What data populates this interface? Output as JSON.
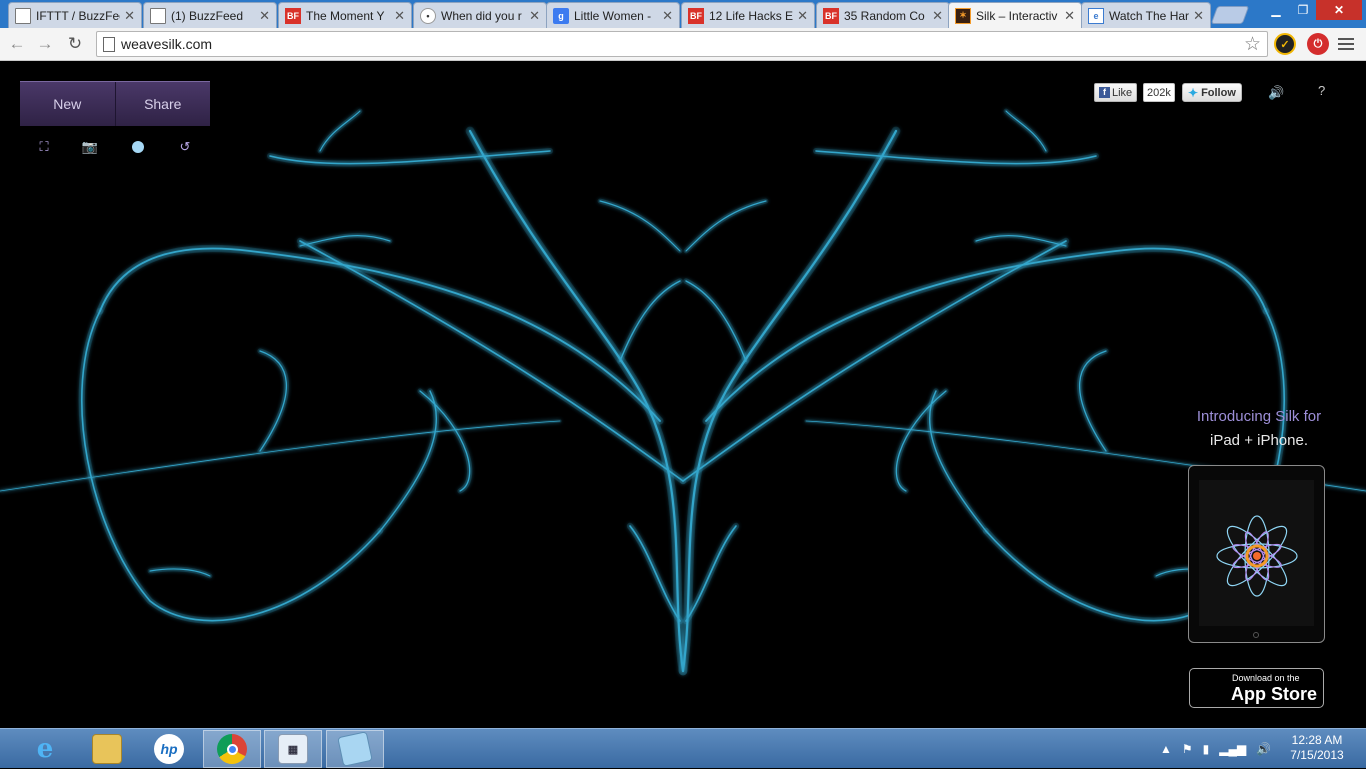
{
  "browser": {
    "tabs": [
      {
        "title": "IFTTT / BuzzFee",
        "favicon": "page-icon",
        "active": false
      },
      {
        "title": "(1) BuzzFeed",
        "favicon": "page-icon",
        "active": false
      },
      {
        "title": "The Moment Y",
        "favicon": "buzzfeed-icon",
        "active": false
      },
      {
        "title": "When did you r",
        "favicon": "reddit-icon",
        "active": false
      },
      {
        "title": "Little Women -",
        "favicon": "google-icon",
        "active": false
      },
      {
        "title": "12 Life Hacks E",
        "favicon": "buzzfeed-icon",
        "active": false
      },
      {
        "title": "35 Random Co",
        "favicon": "buzzfeed-icon",
        "active": false
      },
      {
        "title": "Silk – Interactiv",
        "favicon": "silk-icon",
        "active": true
      },
      {
        "title": "Watch The Har",
        "favicon": "ie-page-icon",
        "active": false
      }
    ],
    "url": "weavesilk.com"
  },
  "silk": {
    "new_label": "New",
    "share_label": "Share",
    "tools": [
      "fullscreen-icon",
      "camera-icon",
      "color-dot-icon",
      "undo-icon"
    ],
    "social": {
      "like_label": "Like",
      "like_count": "202k",
      "follow_label": "Follow"
    },
    "promo": {
      "line1": "Introducing Silk for",
      "line2": "iPad + iPhone.",
      "appstore_small": "Download on the",
      "appstore_big": "App Store"
    },
    "colors": {
      "silk_stroke": "#3fc4f0",
      "accent_purple": "#9d8fd8",
      "button_bg": "#3a2a55"
    }
  },
  "taskbar": {
    "apps": [
      "internet-explorer-icon",
      "file-explorer-icon",
      "hp-icon",
      "chrome-icon",
      "calculator-icon",
      "notepad-icon"
    ],
    "time": "12:28 AM",
    "date": "7/15/2013"
  }
}
